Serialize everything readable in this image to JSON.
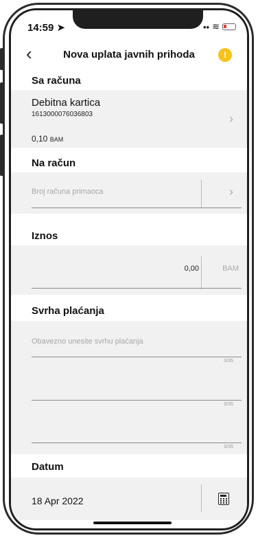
{
  "status": {
    "time": "14:59 ➤",
    "signal": "••",
    "wifi": "≋"
  },
  "nav": {
    "back_glyph": "‹",
    "title": "Nova uplata javnih prihoda",
    "info_glyph": "!"
  },
  "from_account": {
    "title": "Sa računa",
    "card_name": "Debitna kartica",
    "card_number": "1613000076036803",
    "amount": "0,10",
    "currency": "BAM",
    "chevron": "›"
  },
  "to_account": {
    "title": "Na račun",
    "placeholder": "Broj računa primaoca",
    "chevron": "›"
  },
  "amount": {
    "title": "Iznos",
    "value": "0,00",
    "currency": "BAM"
  },
  "purpose": {
    "title": "Svrha plaćanja",
    "placeholder": "Obavezno unesite svrhu plaćanja",
    "counters": [
      "0/35",
      "0/35",
      "0/35"
    ]
  },
  "date": {
    "title": "Datum",
    "value": "18 Apr 2022"
  },
  "colors": {
    "accent": "#f6c21b",
    "section_bg": "#f1f1f1"
  }
}
